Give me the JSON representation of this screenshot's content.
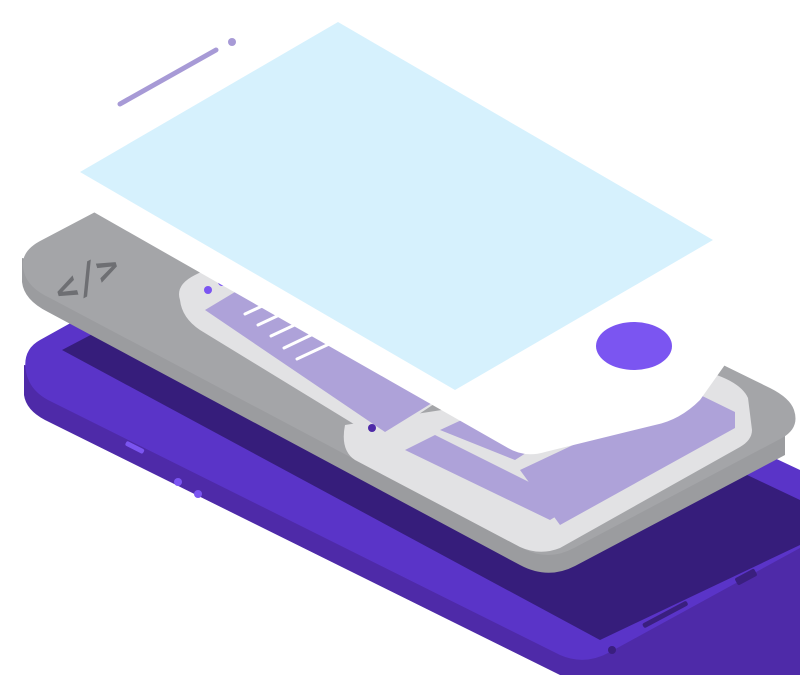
{
  "illustration": {
    "subject": "isometric-phone-layers",
    "layers": [
      {
        "name": "phone-base-layer",
        "color": "#3a1f7f"
      },
      {
        "name": "wireframe-layer",
        "color": "#a9a9a9"
      },
      {
        "name": "screen-layer",
        "color": "#d6f1fd"
      }
    ],
    "code_glyph": "</>",
    "colors": {
      "purple_dark": "#361d7b",
      "purple_mid": "#5a34c8",
      "purple_edge": "#4e2aa8",
      "purple_light": "#a79ad6",
      "accent_purple": "#7b55f1",
      "gray_plate": "#a4a5a8",
      "gray_top": "#d9d9da",
      "gray_card": "#e2e2e4",
      "white_panel": "#ffffff",
      "screen_blue": "#d6f1fd"
    }
  }
}
